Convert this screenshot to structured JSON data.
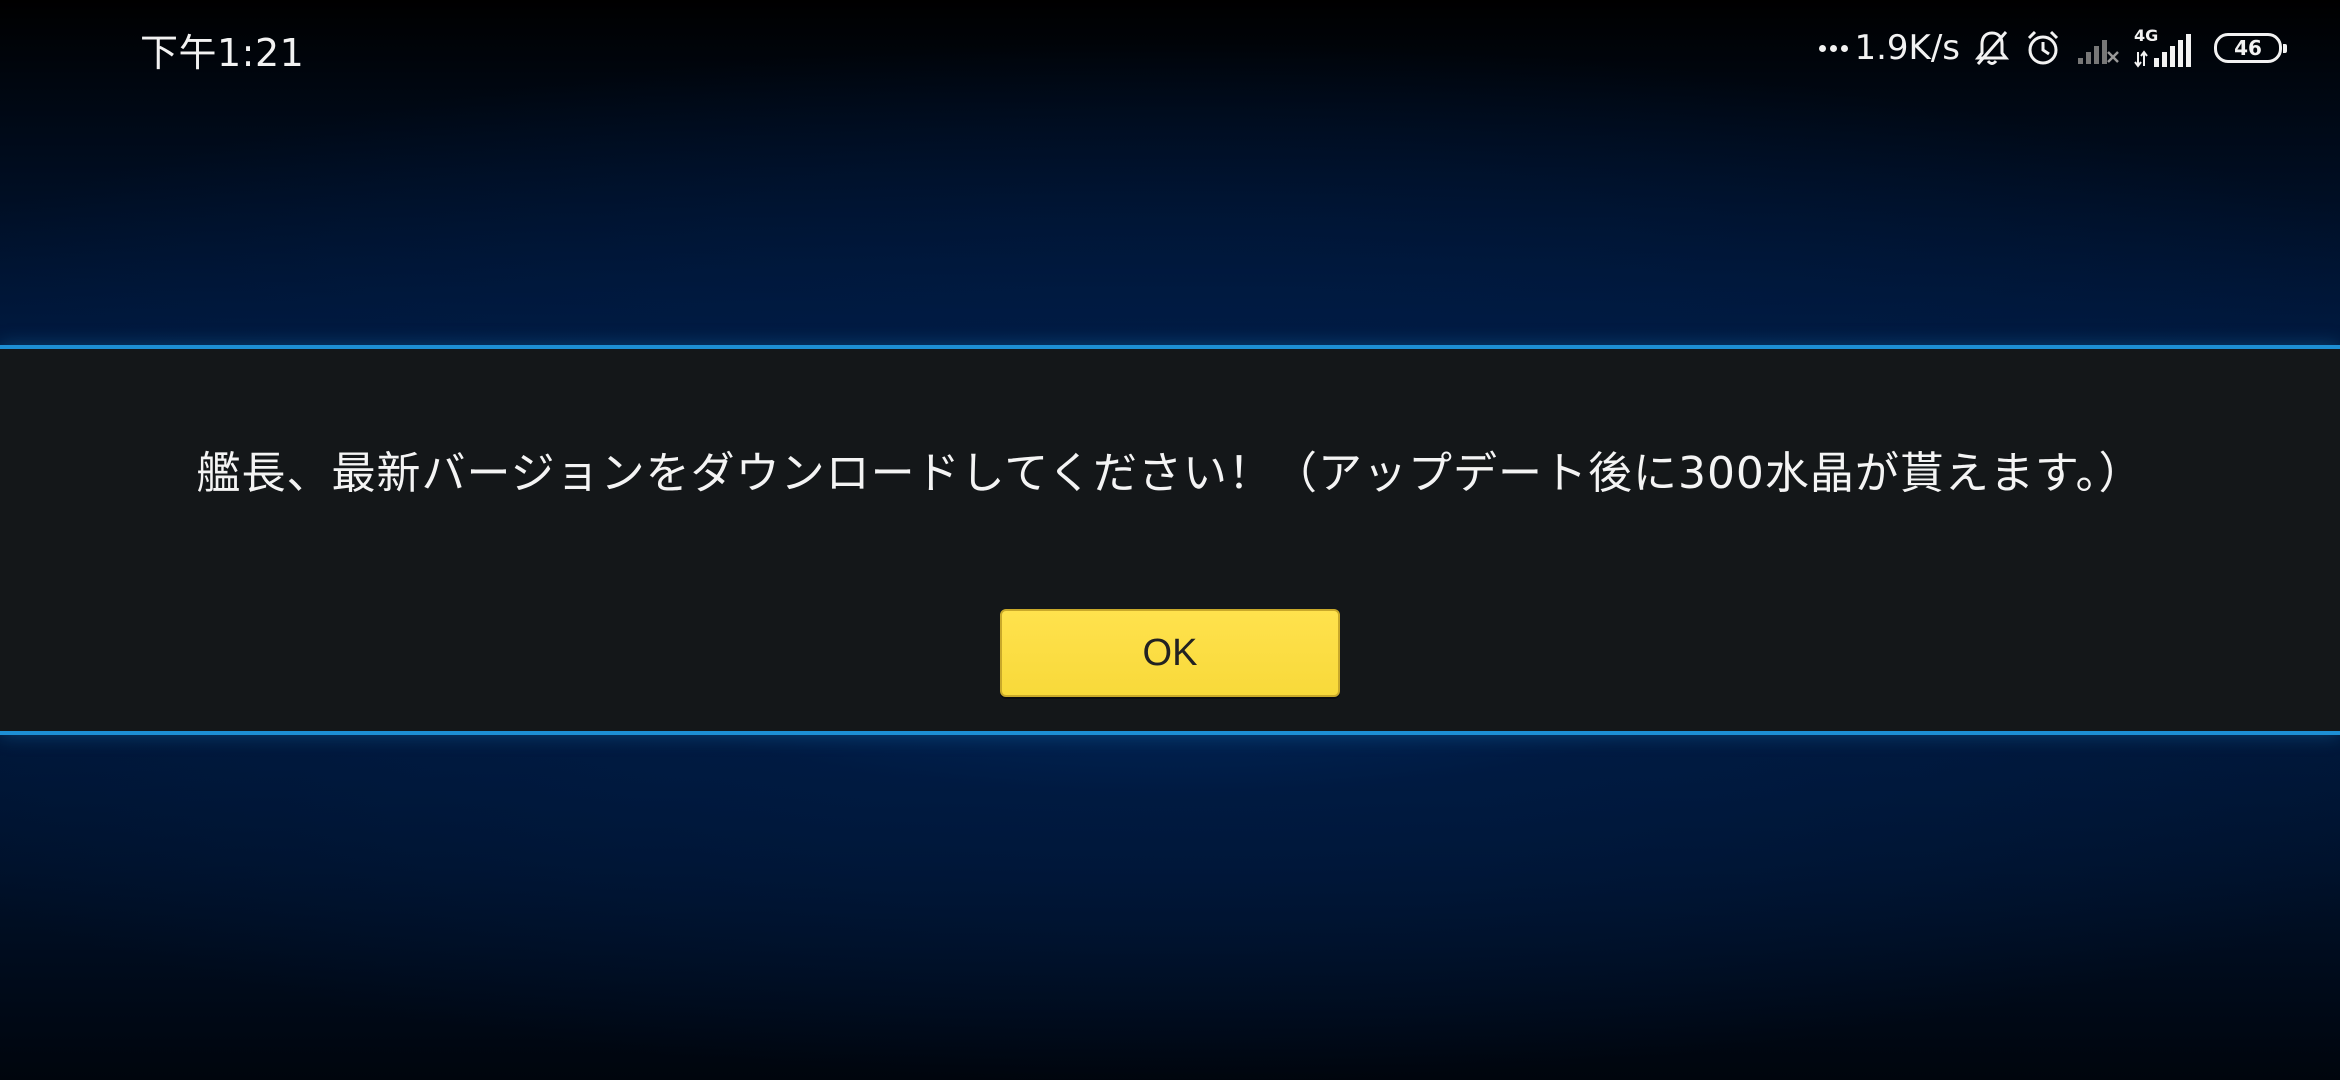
{
  "status_bar": {
    "time": "下午1:21",
    "net_speed": "1.9K/s",
    "network_type": "4G",
    "battery": "46",
    "icons": [
      "more-dots-icon",
      "mute-bell-icon",
      "alarm-icon",
      "signal-weak-icon",
      "signal-4g-icon",
      "battery-icon"
    ]
  },
  "dialog": {
    "message": "艦長、最新バージョンをダウンロードしてください！（アップデート後に300水晶が貰えます。）",
    "ok_label": "OK"
  },
  "colors": {
    "accent_line": "#1d8fd4",
    "button": "#ffe24d",
    "band": "#141719"
  }
}
